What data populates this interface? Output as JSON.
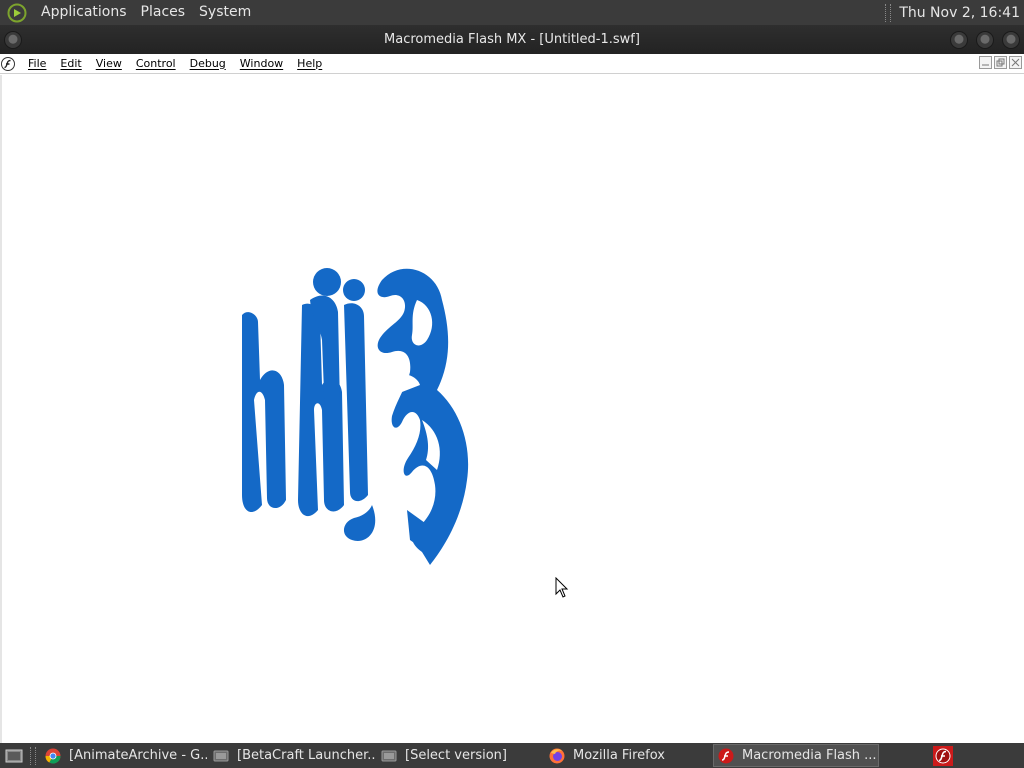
{
  "top_panel": {
    "menus": [
      "Applications",
      "Places",
      "System"
    ],
    "clock": "Thu Nov  2, 16:41"
  },
  "window": {
    "title": "Macromedia Flash MX - [Untitled-1.swf]"
  },
  "menubar": {
    "items": [
      "File",
      "Edit",
      "View",
      "Control",
      "Debug",
      "Window",
      "Help"
    ]
  },
  "stage": {
    "artwork_color": "#1469c7",
    "background": "#ffffff"
  },
  "taskbar": {
    "tasks": [
      {
        "label": "[AnimateArchive - G...",
        "icon": "chrome-icon",
        "active": false
      },
      {
        "label": "[BetaCraft Launcher...",
        "icon": "java-app-icon",
        "active": false
      },
      {
        "label": "[Select version]",
        "icon": "java-app-icon",
        "active": false
      },
      {
        "label": "Mozilla Firefox",
        "icon": "firefox-icon",
        "active": false
      },
      {
        "label": "Macromedia Flash ...",
        "icon": "flash-icon",
        "active": true
      }
    ]
  },
  "colors": {
    "panel_bg": "#3b3b3b",
    "titlebar_bg": "#2a2a2a",
    "flash_red": "#cc1a1a"
  }
}
